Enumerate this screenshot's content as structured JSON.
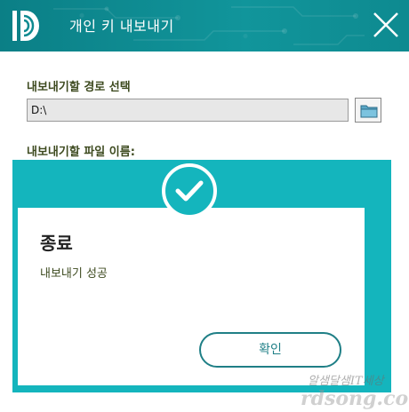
{
  "window": {
    "title": "개인 키 내보내기",
    "colors": {
      "titlebar": "#0e8a90",
      "accent": "#14b5bd",
      "button_border": "#1f7f86"
    }
  },
  "form": {
    "path_label": "내보내기할 경로 선택",
    "path_value": "D:\\",
    "filename_label": "내보내기할 파일 이름:"
  },
  "dialog": {
    "title": "종료",
    "message": "내보내기 성공",
    "ok_label": "확인"
  },
  "watermark": {
    "line1": "알샘달샘IT세상",
    "line2": "rdsong.com"
  },
  "icons": [
    "app-logo-icon",
    "close-icon",
    "folder-icon",
    "check-circle-icon"
  ]
}
